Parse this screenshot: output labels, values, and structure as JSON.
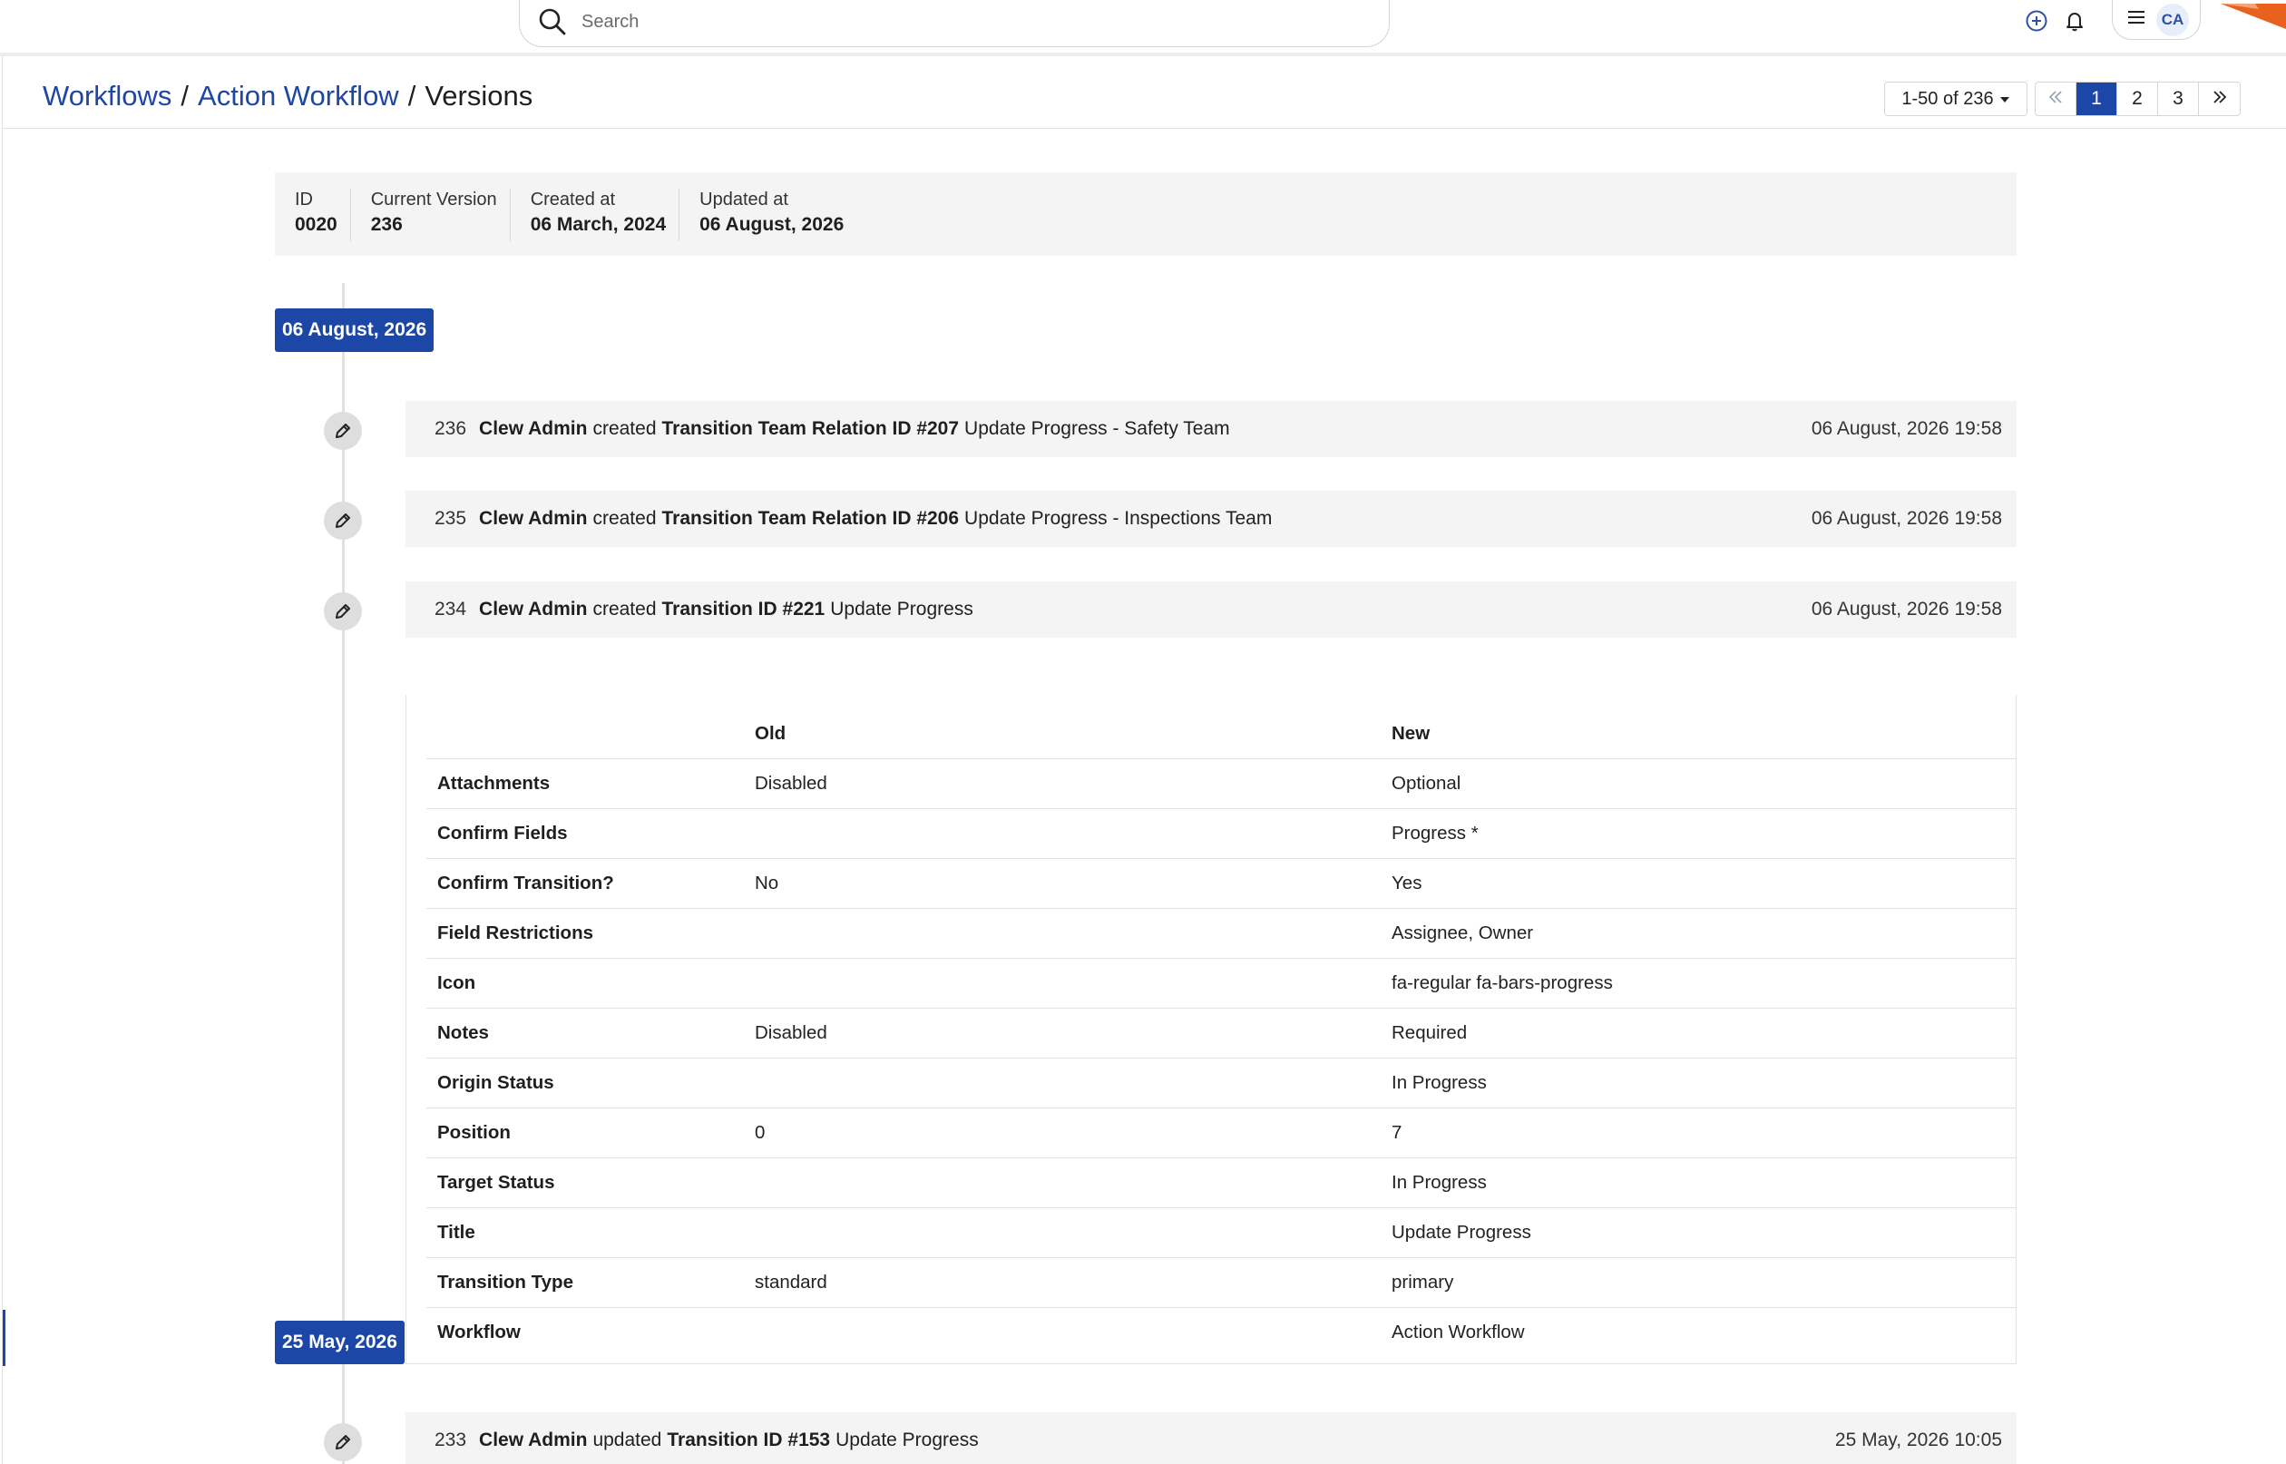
{
  "search": {
    "placeholder": "Search"
  },
  "user": {
    "initials": "CA"
  },
  "breadcrumb": {
    "items": [
      "Workflows",
      "Action Workflow"
    ],
    "separator": "/",
    "current": "Versions"
  },
  "pagination": {
    "range_label": "1-50 of 236",
    "pages": [
      "1",
      "2",
      "3"
    ],
    "active_page": "1",
    "first_label": "«",
    "last_label": "»"
  },
  "summary": {
    "fields": [
      {
        "label": "ID",
        "value": "0020"
      },
      {
        "label": "Current Version",
        "value": "236"
      },
      {
        "label": "Created at",
        "value": "06 March, 2024"
      },
      {
        "label": "Updated at",
        "value": "06 August, 2026"
      }
    ]
  },
  "timeline": {
    "groups": [
      {
        "date": "06 August, 2026"
      },
      {
        "date": "25 May, 2026"
      }
    ],
    "entries": [
      {
        "num": "236",
        "who": "Clew Admin",
        "verb": "created",
        "obj": "Transition Team Relation ID #207",
        "desc": "Update Progress - Safety Team",
        "time": "06 August, 2026 19:58"
      },
      {
        "num": "235",
        "who": "Clew Admin",
        "verb": "created",
        "obj": "Transition Team Relation ID #206",
        "desc": "Update Progress - Inspections Team",
        "time": "06 August, 2026 19:58"
      },
      {
        "num": "234",
        "who": "Clew Admin",
        "verb": "created",
        "obj": "Transition ID #221",
        "desc": "Update Progress",
        "time": "06 August, 2026 19:58"
      },
      {
        "num": "233",
        "who": "Clew Admin",
        "verb": "updated",
        "obj": "Transition ID #153",
        "desc": "Update Progress",
        "time": "25 May, 2026 10:05"
      }
    ]
  },
  "diff": {
    "headers": {
      "field": "",
      "old": "Old",
      "new": "New"
    },
    "rows": [
      {
        "field": "Attachments",
        "old": "Disabled",
        "new": "Optional"
      },
      {
        "field": "Confirm Fields",
        "old": "",
        "new": "Progress *"
      },
      {
        "field": "Confirm Transition?",
        "old": "No",
        "new": "Yes"
      },
      {
        "field": "Field Restrictions",
        "old": "",
        "new": "Assignee, Owner"
      },
      {
        "field": "Icon",
        "old": "",
        "new": "fa-regular fa-bars-progress"
      },
      {
        "field": "Notes",
        "old": "Disabled",
        "new": "Required"
      },
      {
        "field": "Origin Status",
        "old": "",
        "new": "In Progress"
      },
      {
        "field": "Position",
        "old": "0",
        "new": "7"
      },
      {
        "field": "Target Status",
        "old": "",
        "new": "In Progress"
      },
      {
        "field": "Title",
        "old": "",
        "new": "Update Progress"
      },
      {
        "field": "Transition Type",
        "old": "standard",
        "new": "primary"
      },
      {
        "field": "Workflow",
        "old": "",
        "new": "Action Workflow"
      }
    ]
  },
  "icons": [
    "search-icon",
    "add-circle-icon",
    "bell-icon",
    "hamburger-menu-icon",
    "brand-logo",
    "pencil-icon",
    "caret-down-icon",
    "chevron-double-left-icon",
    "chevron-double-right-icon"
  ],
  "colors": {
    "accent": "#1d47a6",
    "brand": "#e8621e",
    "panel_bg": "#f4f4f4"
  }
}
